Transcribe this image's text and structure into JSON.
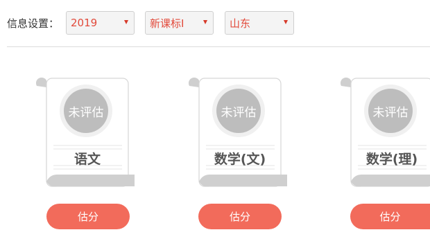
{
  "header": {
    "settings_label": "信息设置：",
    "year": "2019",
    "paper": "新课标I",
    "province": "山东"
  },
  "colors": {
    "accent": "#e24a3b",
    "button": "#f26b5b",
    "badge": "#bdbdbd",
    "divider": "#dcdcdc"
  },
  "subjects": [
    {
      "name": "语文",
      "status": "未评估",
      "button_label": "估分",
      "icon": "scroll-icon"
    },
    {
      "name": "数学(文)",
      "status": "未评估",
      "button_label": "估分",
      "icon": "scroll-icon"
    },
    {
      "name": "数学(理)",
      "status": "未评估",
      "button_label": "估分",
      "icon": "scroll-icon"
    }
  ]
}
